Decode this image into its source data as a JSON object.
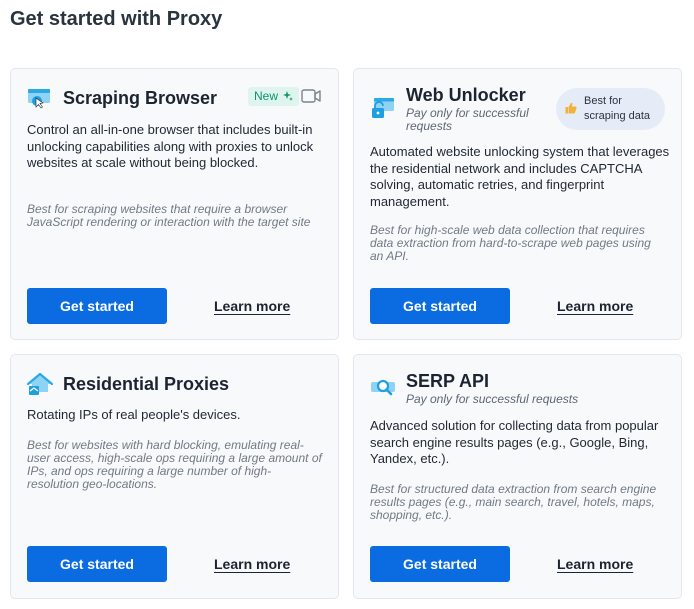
{
  "page": {
    "title": "Get started with Proxy"
  },
  "cards": [
    {
      "title": "Scraping Browser",
      "badge": "New",
      "description": "Control an all-in-one browser that includes built-in unlocking capabilities along with proxies to unlock websites at scale without being blocked.",
      "best_for": "Best for scraping websites that require a browser JavaScript rendering or interaction with the target site",
      "primary_label": "Get started",
      "secondary_label": "Learn more"
    },
    {
      "title": "Web Unlocker",
      "subtitle": "Pay only for successful requests",
      "badge": "Best for scraping data",
      "description": "Automated website unlocking system that leverages the residential network and includes CAPTCHA solving, automatic retries, and fingerprint management.",
      "best_for": "Best for high-scale web data collection that requires data extraction from hard-to-scrape web pages using an API.",
      "primary_label": "Get started",
      "secondary_label": "Learn more"
    },
    {
      "title": "Residential Proxies",
      "description": "Rotating IPs of real people's devices.",
      "best_for": "Best for websites with hard blocking, emulating real-user access, high-scale ops requiring a large amount of IPs, and ops requiring a large number of high-resolution geo-locations.",
      "primary_label": "Get started",
      "secondary_label": "Learn more"
    },
    {
      "title": "SERP API",
      "subtitle": "Pay only for successful requests",
      "description": "Advanced solution for collecting data from popular search engine results pages (e.g., Google, Bing, Yandex, etc.).",
      "best_for": "Best for structured data extraction from search engine results pages (e.g., main search, travel, hotels, maps, shopping, etc.).",
      "primary_label": "Get started",
      "secondary_label": "Learn more"
    }
  ],
  "icons": {
    "scraping_browser": "browser-cursor-icon",
    "web_unlocker": "unlock-icon",
    "residential": "house-icon",
    "serp": "search-icon",
    "video": "video-camera-icon",
    "sparkle": "sparkle-icon",
    "thumb": "thumbs-up-icon"
  },
  "colors": {
    "accent": "#0a6ce0",
    "icon_blue": "#29a9e6",
    "new_badge_text": "#12936b",
    "new_badge_bg": "#def5ee"
  }
}
